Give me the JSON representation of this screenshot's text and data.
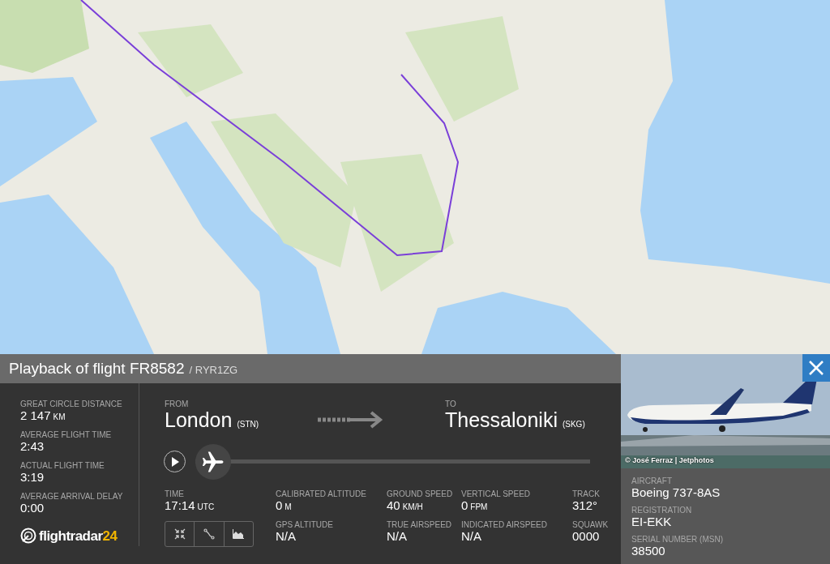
{
  "flight_header": {
    "title": "Playback of flight FR8582",
    "callsign": "/ RYR1ZG"
  },
  "summary": [
    {
      "label": "GREAT CIRCLE DISTANCE",
      "value": "2 147",
      "unit": "KM"
    },
    {
      "label": "AVERAGE FLIGHT TIME",
      "value": "2:43"
    },
    {
      "label": "ACTUAL FLIGHT TIME",
      "value": "3:19"
    },
    {
      "label": "AVERAGE ARRIVAL DELAY",
      "value": "0:00"
    }
  ],
  "logo": {
    "text": "flightradar",
    "suffix": "24"
  },
  "route": {
    "from_label": "FROM",
    "from_city": "London",
    "from_code": "(STN)",
    "to_label": "TO",
    "to_city": "Thessaloniki",
    "to_code": "(SKG)"
  },
  "playback": {
    "playing": false,
    "level": 0
  },
  "time": {
    "label": "TIME",
    "value": "17:14",
    "unit": "UTC"
  },
  "telemetry": [
    {
      "label": "CALIBRATED ALTITUDE",
      "value": "0",
      "unit": "M"
    },
    {
      "label": "GROUND SPEED",
      "value": "40",
      "unit": "KM/H"
    },
    {
      "label": "VERTICAL SPEED",
      "value": "0",
      "unit": "FPM"
    },
    {
      "label": "TRACK",
      "value": "312°"
    },
    {
      "label": "GPS ALTITUDE",
      "value": "N/A"
    },
    {
      "label": "TRUE AIRSPEED",
      "value": "N/A"
    },
    {
      "label": "INDICATED AIRSPEED",
      "value": "N/A"
    },
    {
      "label": "SQUAWK",
      "value": "0000"
    }
  ],
  "aircraft": {
    "photo_credit": "© José Ferraz | Jetphotos",
    "fields": [
      {
        "label": "AIRCRAFT",
        "value": "Boeing 737-8AS"
      },
      {
        "label": "REGISTRATION",
        "value": "EI-EKK"
      },
      {
        "label": "SERIAL NUMBER (MSN)",
        "value": "38500"
      }
    ]
  }
}
